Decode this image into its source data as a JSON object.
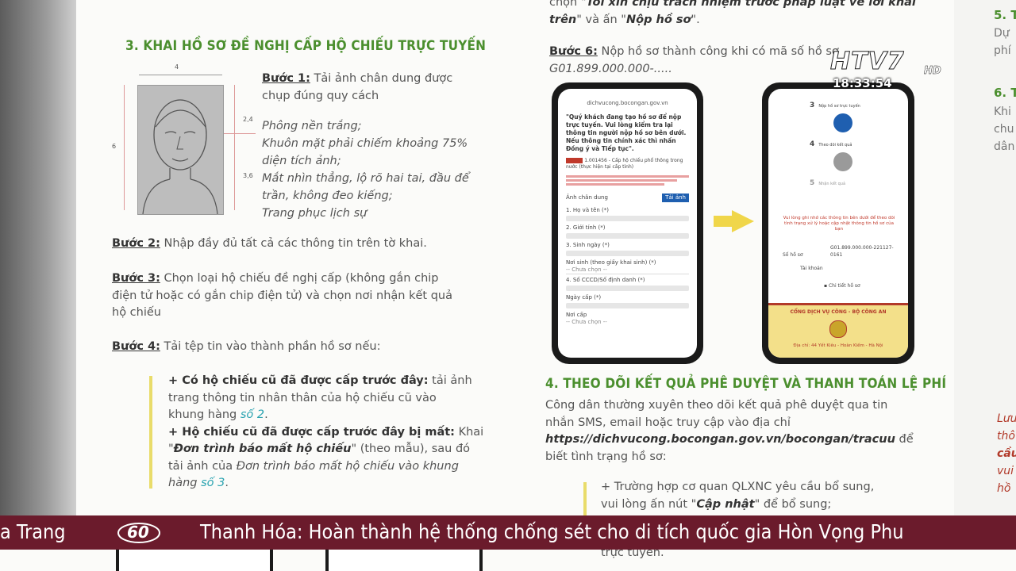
{
  "logo": {
    "brand": "HTV7",
    "hd": "HD",
    "clock": "18:33:54"
  },
  "section3": {
    "heading": "3. KHAI HỒ SƠ ĐỀ NGHỊ CẤP HỘ CHIẾU TRỰC TUYẾN",
    "dims": {
      "top": "4",
      "right1": "2,4",
      "left": "6",
      "right2": "3,6"
    },
    "step1": {
      "label": "Bước 1:",
      "line1": "Tải ảnh chân dung được",
      "line2": "chụp đúng quy cách",
      "req1": "Phông nền trắng;",
      "req2a": "Khuôn mặt phải chiếm khoảng 75%",
      "req2b": "diện tích ảnh;",
      "req3a": "Mắt nhìn thẳng, lộ rõ hai tai, đầu để",
      "req3b": "trần, không đeo kiếng;",
      "req4": "Trang phục lịch sự"
    },
    "step2": {
      "label": "Bước 2:",
      "text": "Nhập đầy đủ tất cả các thông tin trên tờ khai."
    },
    "step3": {
      "label": "Bước 3:",
      "line1": "Chọn loại hộ chiếu đề nghị cấp (không gắn chip",
      "line2": "điện tử hoặc có gắn chip điện tử) và chọn nơi nhận kết quả",
      "line3": "hộ chiếu"
    },
    "step4": {
      "label": "Bước 4:",
      "text": "Tải tệp tin vào thành phần hồ sơ nếu:",
      "b1_bold": "+ Có hộ chiếu cũ đã được cấp trước đây:",
      "b1_text": " tải ảnh",
      "b1_line2": "trang thông tin nhân thân của hộ chiếu cũ vào",
      "b1_line3": "khung hàng ",
      "b1_ref": "số 2",
      "b2_bold": "+ Hộ chiếu cũ đã được cấp trước đây bị mất:",
      "b2_text": " Khai",
      "b2_q1": "\"",
      "b2_form": "Đơn trình báo mất hộ chiếu",
      "b2_q2": "\"",
      "b2_tail": " (theo mẫu), sau đó",
      "b2_line3a": "tải ảnh của ",
      "b2_line3b": "Đơn trình báo mất hộ chiếu vào khung",
      "b2_line4": "hàng ",
      "b2_ref": "số 3",
      "dot": "."
    }
  },
  "right_col": {
    "top_line1a": "chọn \"",
    "top_line1b": "Tôi xin chịu trách nhiệm trước pháp luật về lời khai",
    "top_line2a": "trên",
    "top_line2b": "\" và ấn \"",
    "top_line2c": "Nộp hồ sơ",
    "top_line2d": "\".",
    "step6_label": "Bước 6:",
    "step6_text": " Nộp hồ sơ thành công khi có mã số hồ sơ",
    "step6_code": "G01.899.000.000-.....",
    "phone1": {
      "url": "dichvucong.bocongan.gov.vn",
      "notice": "\"Quý khách đang tạo hồ sơ để nộp trực tuyến. Vui lòng kiểm tra lại thông tin người nộp hồ sơ bên dưới. Nếu thông tin chính xác thì nhấn Đồng ý và Tiếp tục\".",
      "proc": "1.001456 - Cấp hộ chiếu phổ thông trong nước (thực hiện tại cấp tỉnh)",
      "photo_label": "Ảnh chân dung",
      "upload_btn": "Tải ảnh",
      "f1": "1. Họ và tên (*)",
      "f2": "2. Giới tính (*)",
      "f3": "3. Sinh ngày (*)",
      "f4": "Nơi sinh (theo giấy khai sinh) (*)",
      "f4v": "-- Chưa chọn --",
      "f5": "4. Số CCCD/Số định danh (*)",
      "f6": "Ngày cấp (*)",
      "f7": "Nơi cấp",
      "f7v": "-- Chưa chọn --"
    },
    "phone2": {
      "s3": "Nộp hồ sơ trực tuyến",
      "s4": "Theo dõi kết quả",
      "s5": "Nhận kết quả",
      "n3": "3",
      "n4": "4",
      "n5": "5",
      "msg": "Vui lòng ghi nhớ các thông tin bên dưới để theo dõi tình trạng xử lý hoặc cập nhật thông tin hồ sơ của bạn",
      "code_label": "Số hồ sơ",
      "code_value": "G01.899.000.000-221127-0161",
      "acc_label": "Tài khoản",
      "detail": "Chi tiết hồ sơ",
      "footer_title": "CỔNG DỊCH VỤ CÔNG - BỘ CÔNG AN",
      "footer_addr": "Địa chỉ: 44 Yết Kiêu - Hoàn Kiếm - Hà Nội"
    },
    "section4_heading": "4. THEO DÕI KẾT QUẢ PHÊ DUYỆT VÀ THANH TOÁN LỆ PHÍ",
    "s4_line1": "Công dân thường xuyên theo dõi kết quả phê duyệt qua tin",
    "s4_line2": "nhắn SMS, email hoặc truy cập vào địa chỉ",
    "s4_url": "https://dichvucong.bocongan.gov.vn/bocongan/tracuu",
    "s4_url_tail": " để",
    "s4_line4": "biết tình trạng hồ sơ:",
    "s4_b1": "+ Trường hợp cơ quan QLXNC yêu cầu bổ sung,",
    "s4_b2a": "vui lòng ấn nút \"",
    "s4_b2b": "Cập nhật",
    "s4_b2c": "\" để bổ sung;",
    "s4_b3": "trực tuyến."
  },
  "right_page": {
    "l1": "5. T",
    "l2": "Dự",
    "l3": "phí",
    "l4": "6. T",
    "l5": "Khi",
    "l6": "chu",
    "l7": "dân",
    "l8": "Lưu",
    "l9": "thô",
    "l10": "cầu",
    "l11": "vui",
    "l12": "hồ"
  },
  "ticker": {
    "left": "a Trang",
    "logo": "60",
    "headline": "Thanh Hóa: Hoàn thành hệ thống chống sét cho di tích quốc gia Hòn Vọng Phu"
  },
  "colors": {
    "heading_green": "#4b8f2e",
    "ticker_bg": "#6b1b2c",
    "accent_yellow": "#f0d64a",
    "link_teal": "#2aa3b0"
  }
}
